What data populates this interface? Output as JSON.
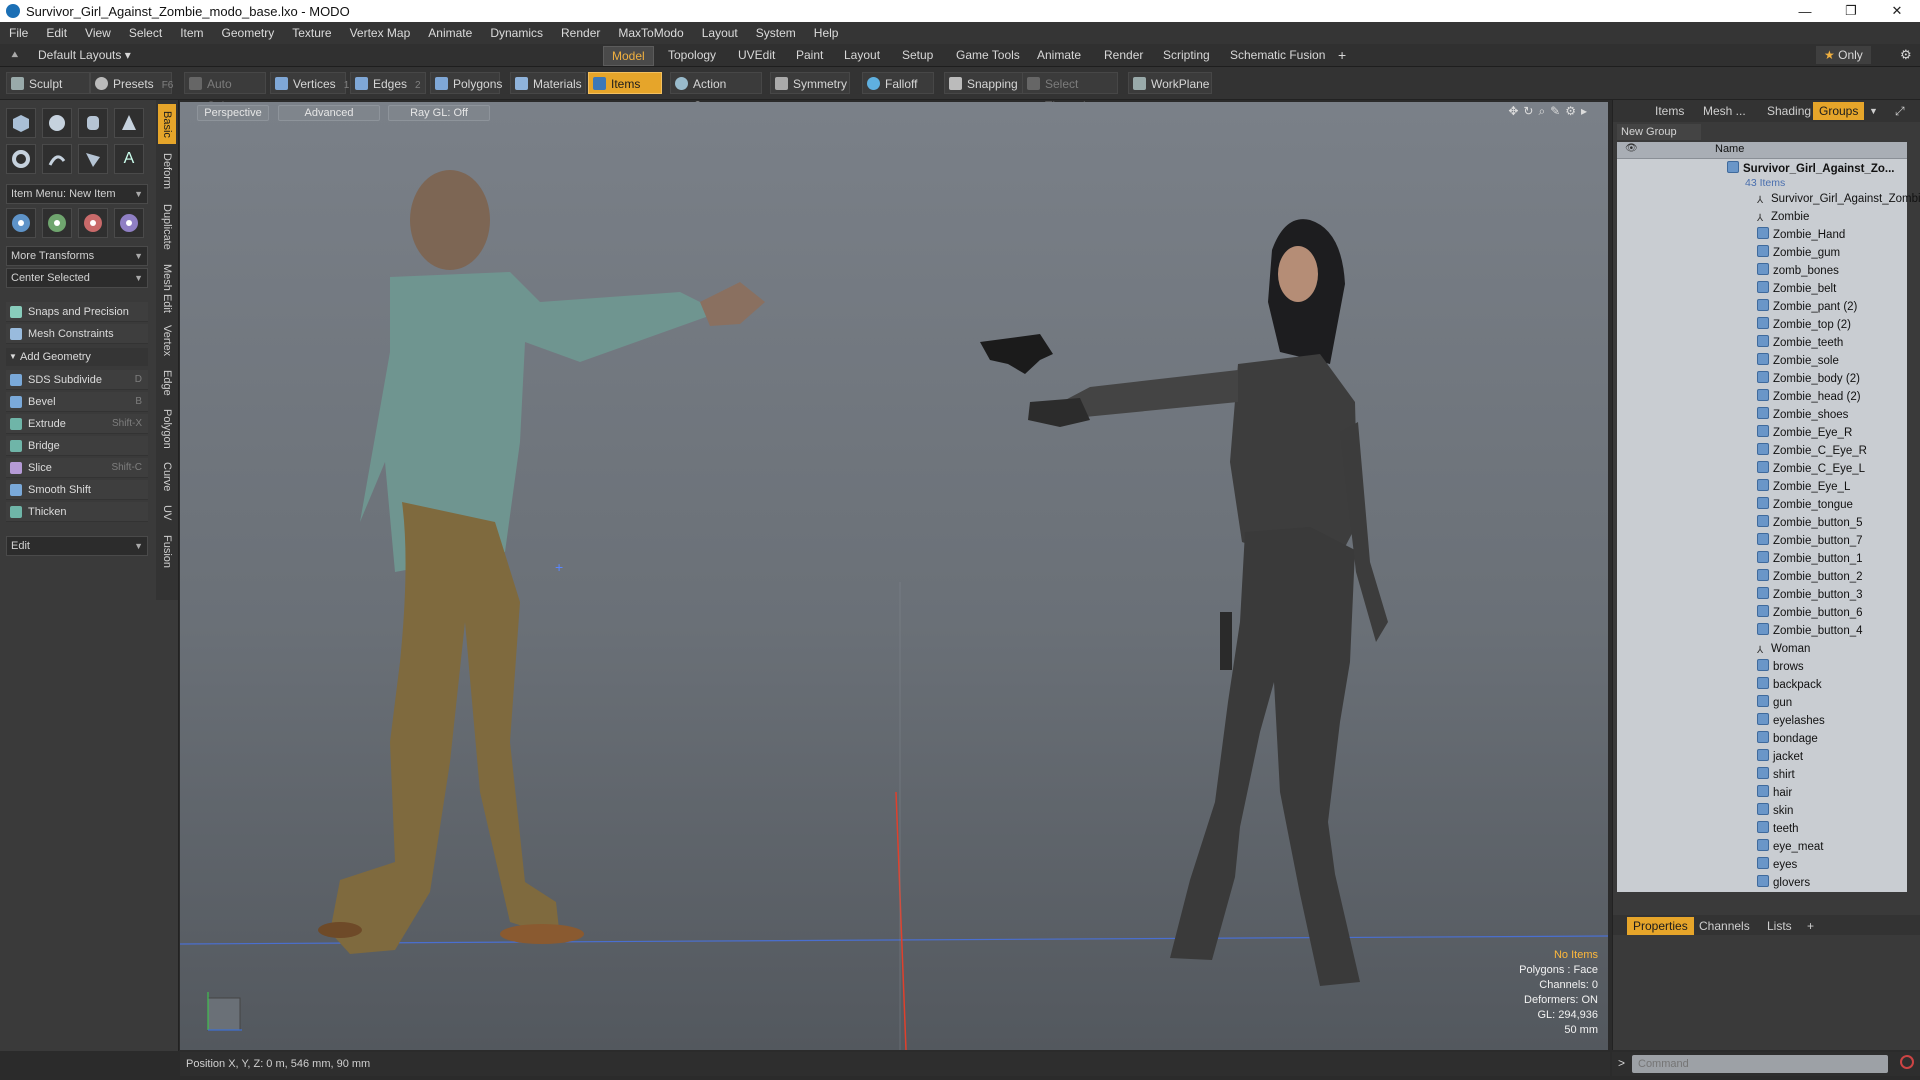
{
  "window": {
    "title": "Survivor_Girl_Against_Zombie_modo_base.lxo - MODO",
    "min_label": "—",
    "max_label": "❐",
    "close_label": "✕"
  },
  "menu": [
    "File",
    "Edit",
    "View",
    "Select",
    "Item",
    "Geometry",
    "Texture",
    "Vertex Map",
    "Animate",
    "Dynamics",
    "Render",
    "MaxToModo",
    "Layout",
    "System",
    "Help"
  ],
  "layoutbar": {
    "preset": "Default Layouts",
    "tabs": [
      "Model",
      "Topology",
      "UVEdit",
      "Paint",
      "Layout",
      "Setup",
      "Game Tools",
      "Animate",
      "Render",
      "Scripting",
      "Schematic Fusion"
    ],
    "active_tab": "Model",
    "plus": "+",
    "only": "Only"
  },
  "toolbar": {
    "sculpt": "Sculpt",
    "presets": "Presets",
    "presets_key": "F6",
    "auto_select": "Auto Select",
    "vertices": "Vertices",
    "vertices_key": "1",
    "edges": "Edges",
    "edges_key": "2",
    "polygons": "Polygons",
    "materials": "Materials",
    "items": "Items",
    "action_center": "Action Center",
    "symmetry": "Symmetry",
    "falloff": "Falloff",
    "snapping": "Snapping",
    "select_through": "Select Through",
    "workplane": "WorkPlane"
  },
  "leftpanel": {
    "item_menu": "Item Menu: New Item",
    "more_transforms": "More Transforms",
    "center_selected": "Center Selected",
    "snaps": "Snaps and Precision",
    "mesh_constraints": "Mesh Constraints",
    "add_geometry": "Add Geometry",
    "tools": [
      {
        "label": "SDS Subdivide",
        "key": "D"
      },
      {
        "label": "Bevel",
        "key": "B"
      },
      {
        "label": "Extrude",
        "key": "Shift-X"
      },
      {
        "label": "Bridge",
        "key": ""
      },
      {
        "label": "Slice",
        "key": "Shift-C"
      },
      {
        "label": "Smooth Shift",
        "key": ""
      },
      {
        "label": "Thicken",
        "key": ""
      }
    ],
    "edit": "Edit",
    "vtabs": [
      "Basic",
      "Deform",
      "Duplicate",
      "Mesh Edit",
      "Vertex",
      "Edge",
      "Polygon",
      "Curve",
      "UV",
      "Fusion"
    ]
  },
  "viewport": {
    "perspective": "Perspective",
    "advanced": "Advanced",
    "raygl": "Ray GL: Off",
    "info_warn": "No Items",
    "info": [
      "Polygons : Face",
      "Channels: 0",
      "Deformers: ON",
      "GL: 294,936",
      "50 mm"
    ]
  },
  "rightpanel": {
    "tabs": [
      "Items",
      "Mesh ...",
      "Shading",
      "Groups"
    ],
    "active_tab": "Groups",
    "new_group": "New Group",
    "name_col": "Name",
    "root": "Survivor_Girl_Against_Zo...",
    "root_count": "43 Items",
    "items": [
      "Survivor_Girl_Against_Zombie",
      "Zombie",
      "Zombie_Hand",
      "Zombie_gum",
      "zomb_bones",
      "Zombie_belt",
      "Zombie_pant (2)",
      "Zombie_top (2)",
      "Zombie_teeth",
      "Zombie_sole",
      "Zombie_body (2)",
      "Zombie_head (2)",
      "Zombie_shoes",
      "Zombie_Eye_R",
      "Zombie_C_Eye_R",
      "Zombie_C_Eye_L",
      "Zombie_Eye_L",
      "Zombie_tongue",
      "Zombie_button_5",
      "Zombie_button_7",
      "Zombie_button_1",
      "Zombie_button_2",
      "Zombie_button_3",
      "Zombie_button_6",
      "Zombie_button_4",
      "Woman",
      "brows",
      "backpack",
      "gun",
      "eyelashes",
      "bondage",
      "jacket",
      "shirt",
      "hair",
      "skin",
      "teeth",
      "eye_meat",
      "eyes",
      "glovers"
    ],
    "bottom_tabs": [
      "Properties",
      "Channels",
      "Lists"
    ],
    "bottom_active": "Properties",
    "bottom_plus": "+"
  },
  "status": {
    "position": "Position X, Y, Z:   0 m, 546 mm, 90 mm",
    "command_placeholder": "Command",
    "prompt": ">"
  },
  "colors": {
    "accent": "#e6a52a",
    "viewport_top": "#7a8088",
    "list_bg": "#c9cdd2"
  }
}
